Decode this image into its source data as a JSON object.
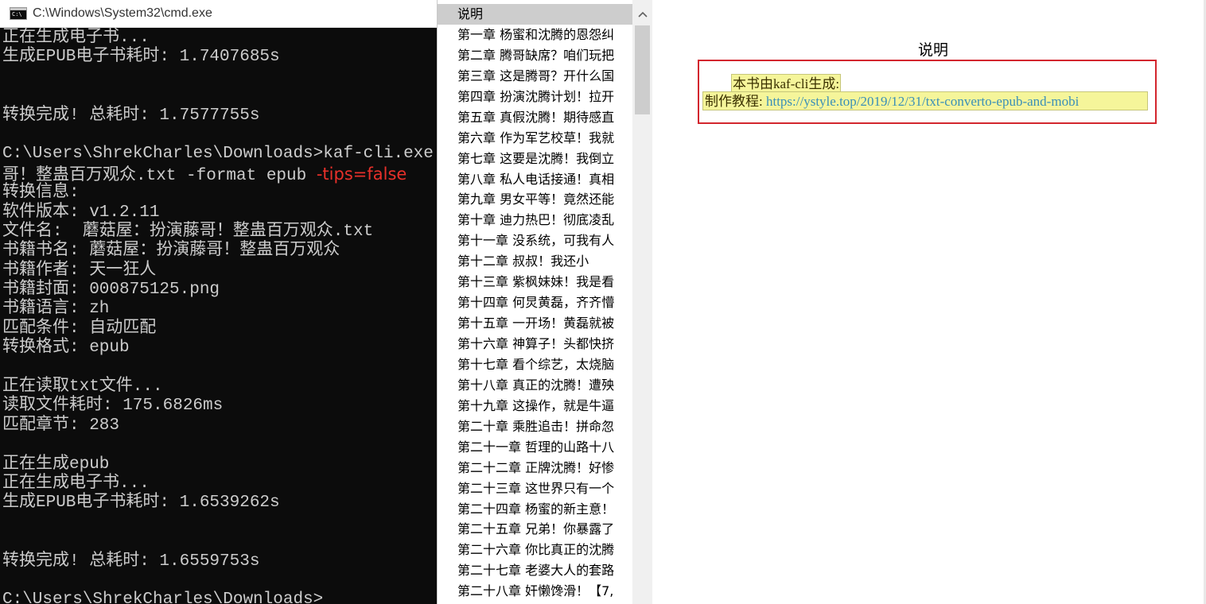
{
  "cmd": {
    "title": "C:\\Windows\\System32\\cmd.exe",
    "icon_label": "C:\\",
    "lines": [
      "正在生成电子书...",
      "生成EPUB电子书耗时: 1.7407685s",
      "",
      "",
      "转换完成! 总耗时: 1.7577755s",
      "",
      "C:\\Users\\ShrekCharles\\Downloads>kaf-cli.exe -a",
      "哥！整蛊百万观众.txt -format epub ",
      "转换信息:",
      "软件版本: v1.2.11",
      "文件名:  蘑菇屋：扮演藤哥！整蛊百万观众.txt",
      "书籍书名: 蘑菇屋：扮演藤哥！整蛊百万观众",
      "书籍作者: 天一狂人",
      "书籍封面: 000875125.png",
      "书籍语言: zh",
      "匹配条件: 自动匹配",
      "转换格式: epub",
      "",
      "正在读取txt文件...",
      "读取文件耗时: 175.6826ms",
      "匹配章节: 283",
      "",
      "正在生成epub",
      "正在生成电子书...",
      "生成EPUB电子书耗时: 1.6539262s",
      "",
      "",
      "转换完成! 总耗时: 1.6559753s",
      "",
      "C:\\Users\\ShrekCharles\\Downloads>"
    ],
    "tips_flag": "-tips=false",
    "accent_color": "#e8302a"
  },
  "toc": {
    "items": [
      "说明",
      "第一章 杨蜜和沈腾的恩怨纠",
      "第二章 腾哥缺席？咱们玩把",
      "第三章 这是腾哥？开什么国",
      "第四章 扮演沈腾计划！拉开",
      "第五章 真假沈腾！期待感直",
      "第六章 作为军艺校草！我就",
      "第七章 这要是沈腾！我倒立",
      "第八章 私人电话接通！真相",
      "第九章 男女平等！竟然还能",
      "第十章 迪力热巴！彻底凌乱",
      "第十一章 没系统，可我有人",
      "第十二章 叔叔！我还小",
      "第十三章 紫枫妹妹！我是看",
      "第十四章 何炅黄磊，齐齐懵",
      "第十五章 一开场！黄磊就被",
      "第十六章 神算子！头都快挤",
      "第十七章 看个综艺，太烧脑",
      "第十八章 真正的沈腾！遭殃",
      "第十九章 这操作，就是牛逼",
      "第二十章 乘胜追击！拼命忽",
      "第二十一章 哲理的山路十八",
      "第二十二章 正牌沈腾！好惨",
      "第二十三章 这世界只有一个",
      "第二十四章 杨蜜的新主意！",
      "第二十五章 兄弟！你暴露了",
      "第二十六章 你比真正的沈腾",
      "第二十七章 老婆大人的套路",
      "第二十八章 奸懒馋滑！【7,"
    ],
    "selected_index": 0
  },
  "content": {
    "title": "说明",
    "line1": "本书由kaf-cli生成:",
    "line2_prefix": "制作教程: ",
    "link_text": "https://ystyle.top/2019/12/31/txt-converto-epub-and-mobi",
    "highlight_color": "#f5f59a",
    "box_color": "#d3262e"
  }
}
